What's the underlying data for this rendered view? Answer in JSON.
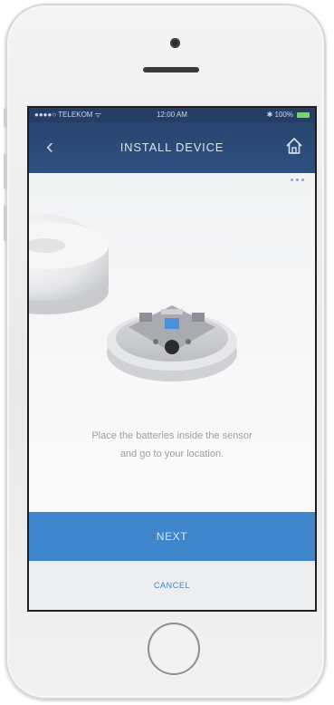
{
  "status_bar": {
    "carrier": "●●●●○ TELEKOM ᯤ",
    "time": "12:00 AM",
    "battery_pct": "✱ 100%"
  },
  "nav": {
    "back_icon": "chevron-left-icon",
    "title": "INSTALL DEVICE",
    "home_icon": "home-icon"
  },
  "instruction": {
    "line1": "Place the batteries inside the sensor",
    "line2": "and go to your location."
  },
  "buttons": {
    "next_label": "NEXT",
    "cancel_label": "CANCEL"
  },
  "colors": {
    "nav_bar": "#2e5180",
    "status_bar": "#243e66",
    "primary_button": "#3f86cd",
    "cancel_text": "#3f86cd",
    "battery": "#7bd36b"
  }
}
